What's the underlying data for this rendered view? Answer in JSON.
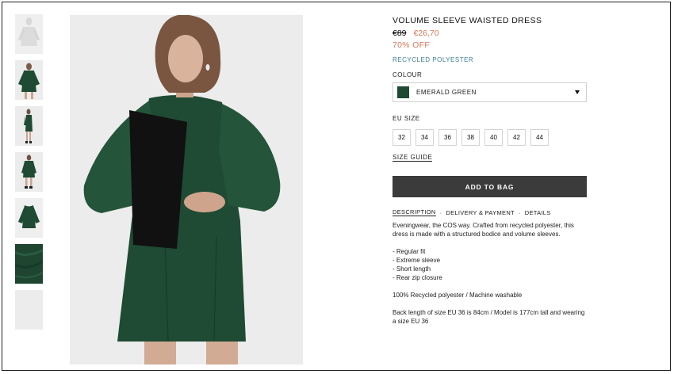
{
  "product": {
    "title": "VOLUME SLEEVE WAISTED DRESS",
    "old_price": "€89",
    "new_price": "€26,70",
    "discount": "70% OFF",
    "material": "RECYCLED POLYESTER",
    "colour_label": "COLOUR",
    "colour_name": "EMERALD GREEN",
    "colour_hex": "#1f4a33",
    "size_label": "EU SIZE",
    "sizes": [
      "32",
      "34",
      "36",
      "38",
      "40",
      "42",
      "44"
    ],
    "size_guide": "SIZE GUIDE",
    "add_to_bag": "ADD TO BAG"
  },
  "tabs": {
    "description": "DESCRIPTION",
    "delivery": "DELIVERY & PAYMENT",
    "details": "DETAILS",
    "separator": "·"
  },
  "description": {
    "intro": "Eveningwear, the COS way. Crafted from recycled polyester, this dress is made with a structured bodice and volume sleeves.",
    "bullets": [
      "- Regular fit",
      "- Extreme sleeve",
      "- Short length",
      "- Rear zip closure"
    ],
    "composition": "100% Recycled polyester / Machine washable",
    "measurements": "Back length of size EU 36 is 84cm / Model is 177cm tall and wearing a size EU 36"
  },
  "colors": {
    "accent_price": "#d9775c",
    "material_link": "#3f7f96",
    "button_bg": "#3b3b3b",
    "dress": "#1f4a33"
  }
}
